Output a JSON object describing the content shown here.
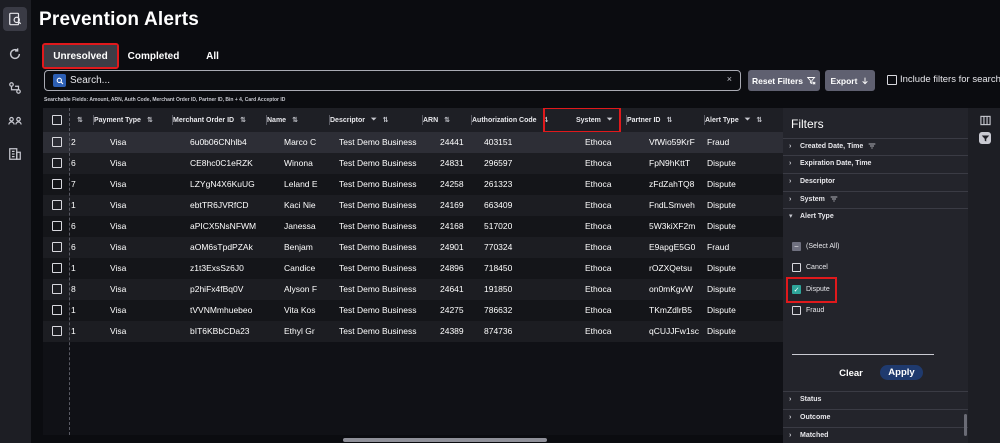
{
  "page_title": "Prevention Alerts",
  "tabs": [
    {
      "label": "Unresolved",
      "active": true
    },
    {
      "label": "Completed",
      "active": false
    },
    {
      "label": "All",
      "active": false
    }
  ],
  "search": {
    "placeholder": "Search...",
    "clear": "×"
  },
  "toolbar": {
    "reset_label": "Reset Filters",
    "export_label": "Export",
    "include_filters_label": "Include filters for search"
  },
  "searchable_hint": "Searchable Fields: Amount, ARN, Auth Code, Merchant Order ID, Partner ID, Bin + 4, Card Acceptor ID",
  "table": {
    "columns": [
      "Payment Type",
      "Merchant Order ID",
      "Name",
      "Descriptor",
      "ARN",
      "Authorization Code",
      "System",
      "Partner ID",
      "Alert Type"
    ],
    "rows": [
      [
        "2",
        "Visa",
        "6u0b06CNhlb4",
        "Marco C",
        "Test Demo Business",
        "24441",
        "403151",
        "Ethoca",
        "VfWio59KrF",
        "Fraud"
      ],
      [
        "6",
        "Visa",
        "CE8hc0C1eRZK",
        "Winona",
        "Test Demo Business",
        "24831",
        "296597",
        "Ethoca",
        "FpN9hKttT",
        "Dispute"
      ],
      [
        "7",
        "Visa",
        "LZYgN4X6KuUG",
        "Leland E",
        "Test Demo Business",
        "24258",
        "261323",
        "Ethoca",
        "zFdZahTQ8",
        "Dispute"
      ],
      [
        "1",
        "Visa",
        "ebtTR6JVRfCD",
        "Kaci Nie",
        "Test Demo Business",
        "24169",
        "663409",
        "Ethoca",
        "FndLSmveh",
        "Dispute"
      ],
      [
        "6",
        "Visa",
        "aPICX5NsNFWM",
        "Janessa",
        "Test Demo Business",
        "24168",
        "517020",
        "Ethoca",
        "5W3kiXF2m",
        "Dispute"
      ],
      [
        "6",
        "Visa",
        "aOM6sTpdPZAk",
        "Benjam",
        "Test Demo Business",
        "24901",
        "770324",
        "Ethoca",
        "E9apgE5G0",
        "Fraud"
      ],
      [
        "1",
        "Visa",
        "z1t3ExsSz6J0",
        "Candice",
        "Test Demo Business",
        "24896",
        "718450",
        "Ethoca",
        "rOZXQetsu",
        "Dispute"
      ],
      [
        "8",
        "Visa",
        "p2hiFx4fBq0V",
        "Alyson F",
        "Test Demo Business",
        "24641",
        "191850",
        "Ethoca",
        "on0mKgvW",
        "Dispute"
      ],
      [
        "1",
        "Visa",
        "tVVNMmhuebeo",
        "Vita Kos",
        "Test Demo Business",
        "24275",
        "786632",
        "Ethoca",
        "TKmZdlrB5",
        "Dispute"
      ],
      [
        "1",
        "Visa",
        "bIT6KBbCDa23",
        "Ethyl Gr",
        "Test Demo Business",
        "24389",
        "874736",
        "Ethoca",
        "qCUJJFw1sc",
        "Dispute"
      ]
    ]
  },
  "filters": {
    "title": "Filters",
    "sections_top": [
      {
        "label": "Created Date, Time",
        "filter_icon": true
      },
      {
        "label": "Expiration Date, Time",
        "filter_icon": false
      },
      {
        "label": "Descriptor",
        "filter_icon": false
      },
      {
        "label": "System",
        "filter_icon": true
      },
      {
        "label": "Alert Type",
        "filter_icon": false
      }
    ],
    "alert_type_options": [
      {
        "label": "(Select All)",
        "state": "indeterminate"
      },
      {
        "label": "Cancel",
        "state": "unchecked"
      },
      {
        "label": "Dispute",
        "state": "checked"
      },
      {
        "label": "Fraud",
        "state": "unchecked"
      }
    ],
    "clear_label": "Clear",
    "apply_label": "Apply",
    "sections_bottom": [
      {
        "label": "Status"
      },
      {
        "label": "Outcome"
      },
      {
        "label": "Matched"
      }
    ]
  },
  "colors": {
    "accent": "#1f3a6e",
    "highlight_outline": "#e0191c",
    "checked": "#2ea59a"
  }
}
